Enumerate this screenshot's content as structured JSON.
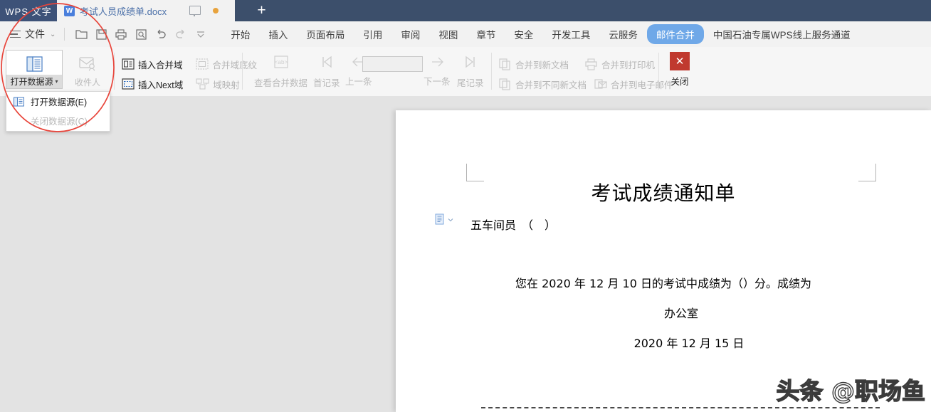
{
  "titlebar": {
    "app_name": "WPS 文字",
    "tab_title": "考试人员成绩单.docx",
    "tab_icon": "word-doc-icon",
    "monitor_icon": "monitor-icon",
    "unsaved_dot": "unsaved-dot",
    "new_tab_label": "+"
  },
  "menubar": {
    "file_label": "文件",
    "chevron": "⌄",
    "quick_access": [
      {
        "name": "open-icon"
      },
      {
        "name": "save-icon"
      },
      {
        "name": "print-icon"
      },
      {
        "name": "print-preview-icon"
      },
      {
        "name": "undo-icon"
      },
      {
        "name": "redo-icon"
      },
      {
        "name": "more-commands-icon"
      }
    ],
    "tabs": [
      {
        "label": "开始",
        "active": false
      },
      {
        "label": "插入",
        "active": false
      },
      {
        "label": "页面布局",
        "active": false
      },
      {
        "label": "引用",
        "active": false
      },
      {
        "label": "审阅",
        "active": false
      },
      {
        "label": "视图",
        "active": false
      },
      {
        "label": "章节",
        "active": false
      },
      {
        "label": "安全",
        "active": false
      },
      {
        "label": "开发工具",
        "active": false
      },
      {
        "label": "云服务",
        "active": false
      },
      {
        "label": "邮件合并",
        "active": true
      },
      {
        "label": "中国石油专属WPS线上服务通道",
        "active": false
      }
    ],
    "active_tab_color": "#6fa8e8"
  },
  "ribbon": {
    "open_data_source": {
      "label": "打开数据源",
      "caret": "▾",
      "pressed": true
    },
    "recipients": {
      "label": "收件人",
      "disabled": true
    },
    "fields": [
      {
        "label": "插入合并域",
        "disabled": false
      },
      {
        "label": "合并域底纹",
        "disabled": true
      },
      {
        "label": "插入Next域",
        "disabled": false
      },
      {
        "label": "域映射",
        "disabled": true
      }
    ],
    "navigation": [
      {
        "label": "查看合并数据",
        "disabled": true
      },
      {
        "label": "首记录",
        "disabled": true
      },
      {
        "label": "上一条",
        "disabled": true
      },
      {
        "label": "下一条",
        "disabled": true
      },
      {
        "label": "尾记录",
        "disabled": true
      }
    ],
    "record_box_value": "",
    "merge": [
      {
        "label": "合并到新文档",
        "disabled": true
      },
      {
        "label": "合并到打印机",
        "disabled": true
      },
      {
        "label": "合并到不同新文档",
        "disabled": true
      },
      {
        "label": "合并到电子邮件",
        "disabled": true
      }
    ],
    "close": {
      "label": "关闭",
      "glyph": "✕",
      "color": "#c0392f"
    }
  },
  "dropdown": {
    "items": [
      {
        "label": "打开数据源(E)",
        "disabled": false,
        "icon": "data-source-icon"
      },
      {
        "label": "关闭数据源(C)",
        "disabled": true,
        "icon": ""
      }
    ]
  },
  "document": {
    "title": "考试成绩通知单",
    "name_line": "五车间员　（　）",
    "field_icon": "merge-field-icon",
    "body": "您在 2020 年 12 月 10 日的考试中成绩为（）分。成绩为",
    "signature": "办公室",
    "date": "2020 年 12 月 15 日",
    "watermark": "头条 @职场鱼"
  },
  "annotation": {
    "shape": "red-ellipse-highlight",
    "color": "#e8443a"
  }
}
